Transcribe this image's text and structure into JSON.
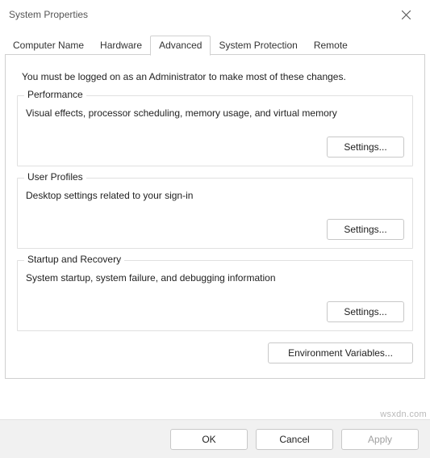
{
  "window": {
    "title": "System Properties"
  },
  "tabs": {
    "computer_name": "Computer Name",
    "hardware": "Hardware",
    "advanced": "Advanced",
    "system_protection": "System Protection",
    "remote": "Remote",
    "active": "advanced"
  },
  "intro": "You must be logged on as an Administrator to make most of these changes.",
  "groups": {
    "performance": {
      "legend": "Performance",
      "desc": "Visual effects, processor scheduling, memory usage, and virtual memory",
      "button": "Settings..."
    },
    "user_profiles": {
      "legend": "User Profiles",
      "desc": "Desktop settings related to your sign-in",
      "button": "Settings..."
    },
    "startup": {
      "legend": "Startup and Recovery",
      "desc": "System startup, system failure, and debugging information",
      "button": "Settings..."
    }
  },
  "env_button": "Environment Variables...",
  "footer": {
    "ok": "OK",
    "cancel": "Cancel",
    "apply": "Apply"
  },
  "watermark": "wsxdn.com"
}
